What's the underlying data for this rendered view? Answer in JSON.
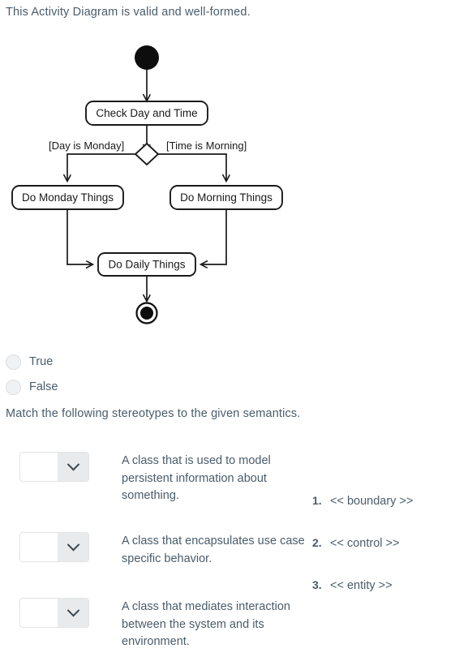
{
  "question": {
    "statement": "This Activity Diagram is valid and well-formed.",
    "options": [
      {
        "label": "True",
        "selected": false
      },
      {
        "label": "False",
        "selected": false
      }
    ]
  },
  "diagram": {
    "type": "UML Activity Diagram",
    "initial_node": "initial-node",
    "final_node": "final-node",
    "decision_node": "decision-diamond",
    "actions": [
      {
        "id": "check-day-and-time",
        "label": "Check Day and Time"
      },
      {
        "id": "do-monday-things",
        "label": "Do Monday Things"
      },
      {
        "id": "do-morning-things",
        "label": "Do Morning Things"
      },
      {
        "id": "do-daily-things",
        "label": "Do Daily Things"
      }
    ],
    "guards": [
      {
        "id": "guard-day-is-monday",
        "label": "[Day is Monday]"
      },
      {
        "id": "guard-time-is-morning",
        "label": "[Time is Morning]"
      }
    ],
    "stroke_color": "#1a1a1a",
    "fill_color": "#ffffff"
  },
  "matching": {
    "instruction": "Match the following stereotypes to the given semantics.",
    "rows": [
      {
        "select_value": "",
        "description": "A class that is used to model persistent information about something."
      },
      {
        "select_value": "",
        "description": "A class that encapsulates use case specific behavior."
      },
      {
        "select_value": "",
        "description": "A class that mediates interaction between the system and its environment."
      }
    ],
    "answers": [
      {
        "number": "1.",
        "text": "<< boundary >>"
      },
      {
        "number": "2.",
        "text": "<< control >>"
      },
      {
        "number": "3.",
        "text": "<< entity >>"
      }
    ]
  }
}
